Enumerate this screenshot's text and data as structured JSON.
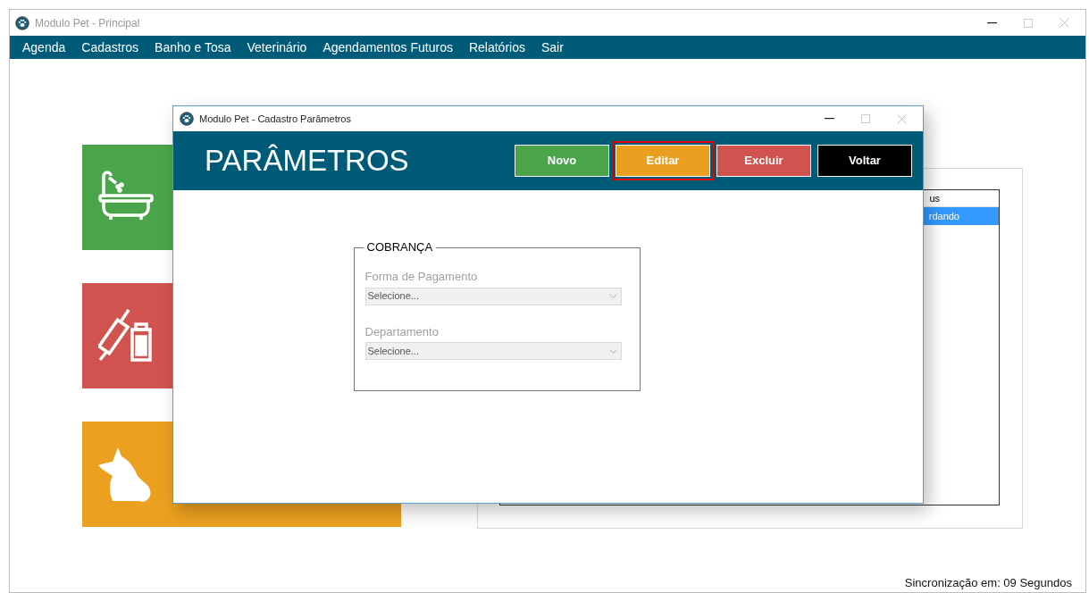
{
  "main_window": {
    "title": "Modulo Pet - Principal",
    "menu": [
      "Agenda",
      "Cadastros",
      "Banho e Tosa",
      "Veterinário",
      "Agendamentos Futuros",
      "Relatórios",
      "Sair"
    ]
  },
  "tiles": [
    {
      "kind": "bath",
      "color": "#4aa44a"
    },
    {
      "kind": "vet",
      "color": "#d05350"
    },
    {
      "kind": "pet",
      "color": "#eba020"
    }
  ],
  "list": {
    "column_header": "us",
    "rows": [
      {
        "text": "rdando",
        "selected": true
      }
    ]
  },
  "status_bar": "Sincronização em: 09 Segundos",
  "dialog": {
    "title": "Modulo Pet - Cadastro Parâmetros",
    "heading": "PARÂMETROS",
    "buttons": [
      {
        "label": "Novo",
        "color": "#4aa44a",
        "highlighted": false
      },
      {
        "label": "Editar",
        "color": "#eb9f20",
        "highlighted": true
      },
      {
        "label": "Excluir",
        "color": "#d05350",
        "highlighted": false
      },
      {
        "label": "Voltar",
        "color": "#000000",
        "highlighted": false
      }
    ],
    "group": {
      "title": "COBRANÇA",
      "fields": [
        {
          "label": "Forma de Pagamento",
          "value": "Selecione...",
          "disabled": true
        },
        {
          "label": "Departamento",
          "value": "Selecione...",
          "disabled": true
        }
      ]
    }
  }
}
